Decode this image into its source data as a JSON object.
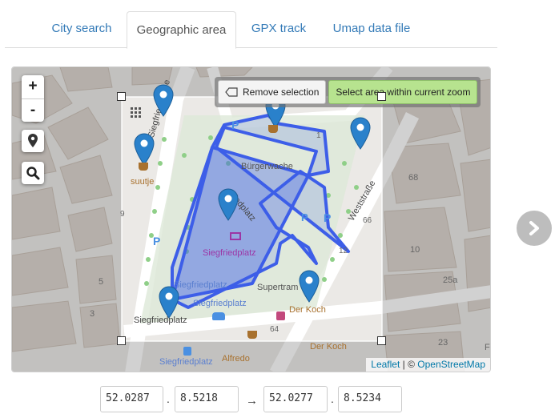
{
  "tabs": [
    {
      "label": "City search"
    },
    {
      "label": "Geographic area"
    },
    {
      "label": "GPX track"
    },
    {
      "label": "Umap data file"
    }
  ],
  "active_tab": "Geographic area",
  "map": {
    "zoom_in": "+",
    "zoom_out": "-",
    "remove_selection": "Remove selection",
    "select_area": "Select area within current zoom",
    "attribution": {
      "leaflet": "Leaflet",
      "separator": " | © ",
      "osm": "OpenStreetMap"
    },
    "labels": {
      "street1": "Siegfriedstraße",
      "street2": "Weststraße",
      "square": "Siegfriedplatz",
      "square_center": "Siegfriedplatz",
      "square_sw1": "Siegfriedplatz",
      "square_sw2": "Siegfriedplatz",
      "square_bottom": "Siegfriedplatz",
      "square_left": "Siegfriedplatz",
      "poi_burgerwache": "Bürgerwache",
      "poi_suutje": "suutje",
      "poi_supertram": "Supertram",
      "poi_derkoch1": "Der Koch",
      "poi_derkoch2": "Der Koch",
      "poi_alfredo": "Alfredo",
      "street_frag": "iedplatz",
      "num_1": "1",
      "num_68": "68",
      "num_66": "66",
      "num_12": "12",
      "num_10": "10",
      "num_9": "9",
      "num_5": "5",
      "num_3": "3",
      "num_64": "64",
      "num_25a": "25a",
      "num_23": "23",
      "letter_f": "F"
    }
  },
  "coordinates": {
    "lat1": "52.0287",
    "lon1": "8.5218",
    "lat2": "52.0277",
    "lon2": "8.5234",
    "dot": ".",
    "arrow": "→"
  },
  "colors": {
    "link": "#337ab7",
    "selection": "#3d5ee8",
    "marker": "#2a81cb",
    "select_button": "#b7e38f"
  },
  "icons": [
    "zoom-in-icon",
    "zoom-out-icon",
    "location-pin-icon",
    "search-icon",
    "eraser-icon",
    "chevron-right-icon",
    "map-marker-icon"
  ]
}
